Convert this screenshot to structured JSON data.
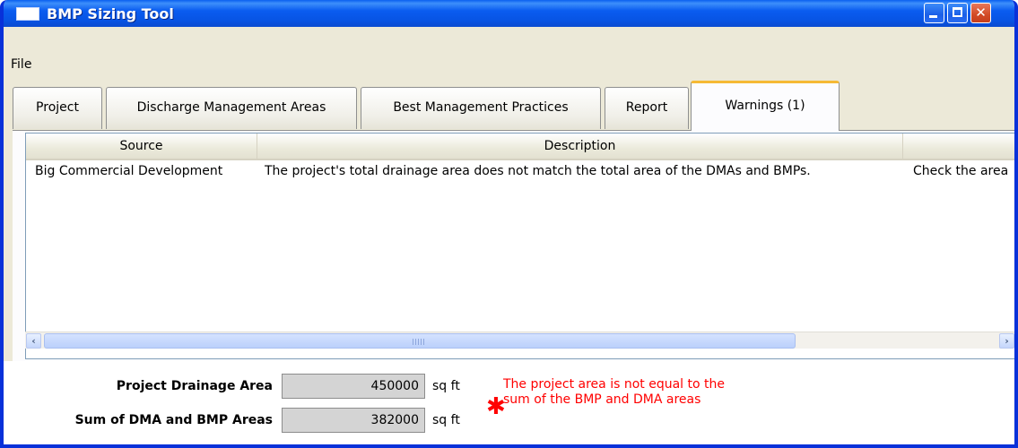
{
  "window": {
    "title": "BMP Sizing Tool"
  },
  "menu": {
    "file": "File"
  },
  "tabs": [
    {
      "label": "Project"
    },
    {
      "label": "Discharge Management Areas"
    },
    {
      "label": "Best Management Practices"
    },
    {
      "label": "Report"
    },
    {
      "label": "Warnings (1)",
      "active": true
    }
  ],
  "warnings_grid": {
    "columns": [
      "Source",
      "Description",
      ""
    ],
    "rows": [
      {
        "source": "Big Commercial Development",
        "description": "The project's total drainage area does not match the total area of the DMAs and BMPs.",
        "action": "Check the area"
      }
    ]
  },
  "footer": {
    "project_drainage_label": "Project Drainage Area",
    "project_drainage_value": "450000",
    "sum_label": "Sum of DMA and BMP Areas",
    "sum_value": "382000",
    "unit": "sq ft",
    "warning_message": "The project area is not equal to the sum of the BMP and DMA areas",
    "warning_color": "#ff0000"
  },
  "icons": {
    "minimize": "minimize-icon",
    "maximize": "maximize-icon",
    "close": "close-icon",
    "scroll_left": "chevron-left-icon",
    "scroll_right": "chevron-right-icon"
  }
}
